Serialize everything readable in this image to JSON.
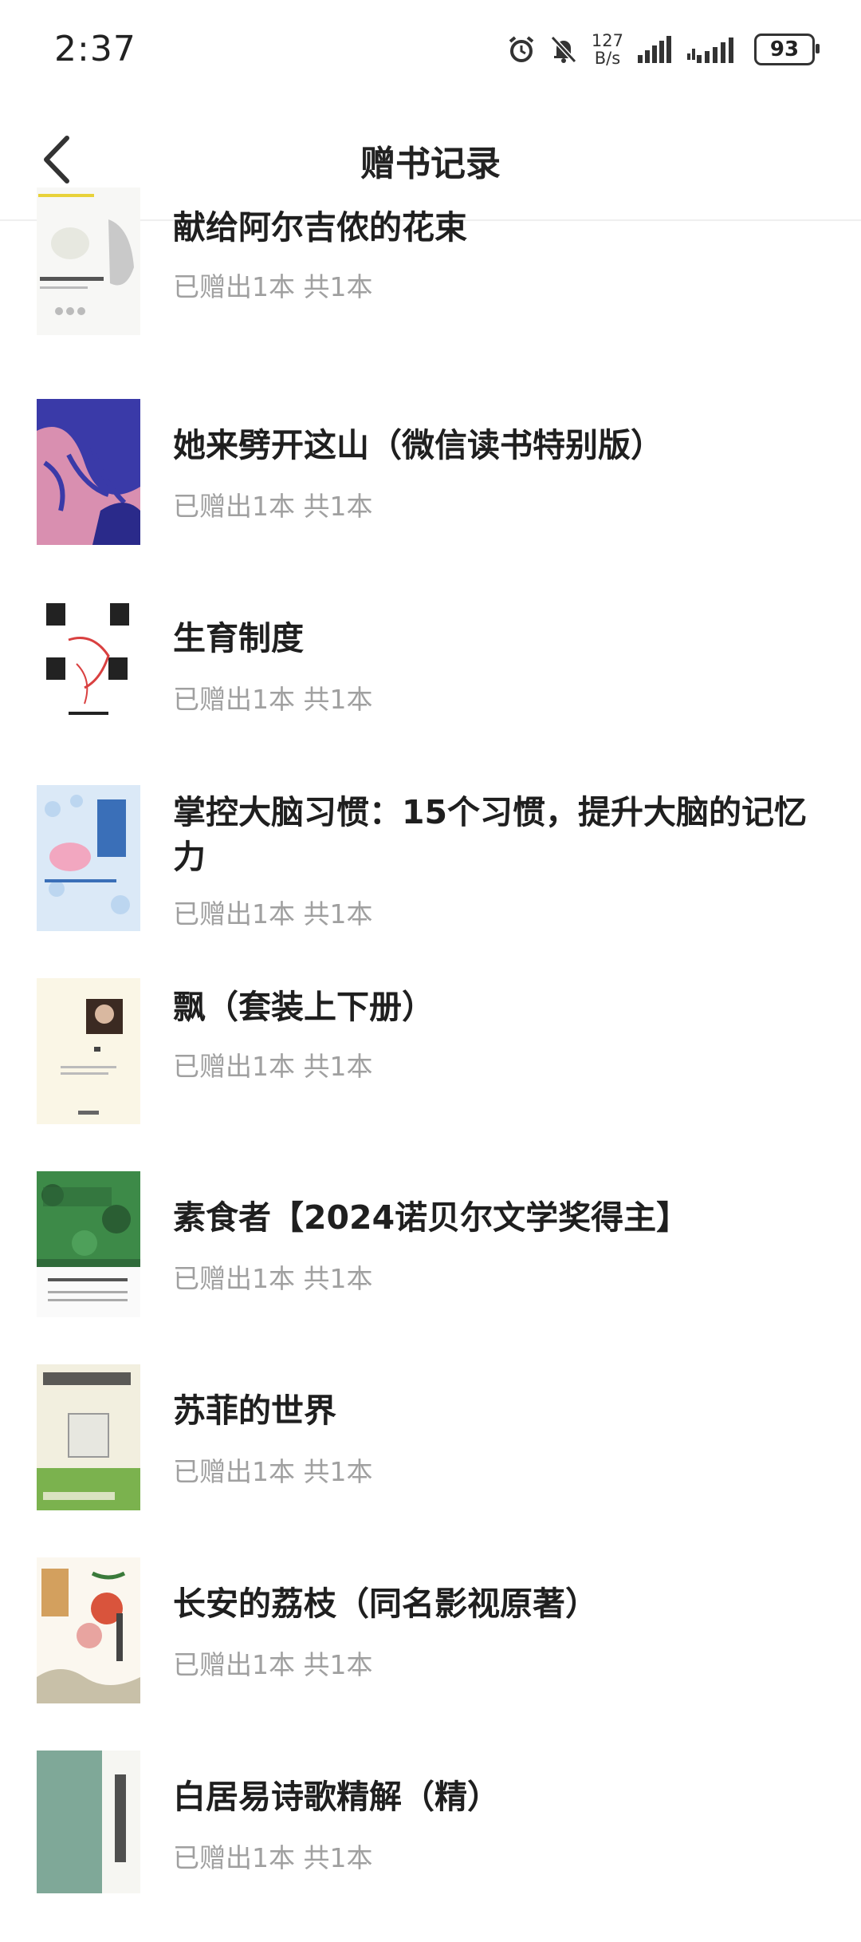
{
  "status": {
    "time": "2:37",
    "net_speed_value": "127",
    "net_speed_unit": "B/s",
    "battery": "93"
  },
  "header": {
    "title": "赠书记录"
  },
  "colors": {
    "background": "#ffffff",
    "title": "#1f1f1f",
    "subtext": "#a0a0a0"
  },
  "books": [
    {
      "title": "献给阿尔吉侬的花束",
      "status": "已赠出1本 共1本",
      "cover_icon": "algernon-cover"
    },
    {
      "title": "她来劈开这山（微信读书特别版）",
      "status": "已赠出1本 共1本",
      "cover_icon": "mountain-cover"
    },
    {
      "title": "生育制度",
      "status": "已赠出1本 共1本",
      "cover_icon": "fertility-system-cover"
    },
    {
      "title": "掌控大脑习惯：15个习惯，提升大脑的记忆力",
      "status": "已赠出1本 共1本",
      "cover_icon": "brain-habits-cover"
    },
    {
      "title": "飘（套装上下册）",
      "status": "已赠出1本 共1本",
      "cover_icon": "gone-with-wind-cover"
    },
    {
      "title": "素食者【2024诺贝尔文学奖得主】",
      "status": "已赠出1本 共1本",
      "cover_icon": "vegetarian-cover"
    },
    {
      "title": "苏菲的世界",
      "status": "已赠出1本 共1本",
      "cover_icon": "sophies-world-cover"
    },
    {
      "title": "长安的荔枝（同名影视原著）",
      "status": "已赠出1本 共1本",
      "cover_icon": "lychee-cover"
    },
    {
      "title": "白居易诗歌精解（精）",
      "status": "已赠出1本 共1本",
      "cover_icon": "bai-juyi-cover"
    }
  ]
}
